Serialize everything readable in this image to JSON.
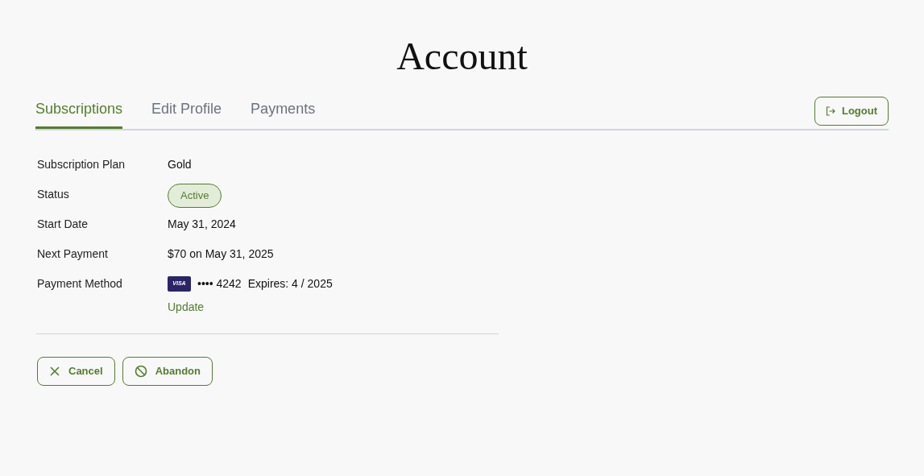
{
  "title": "Account",
  "tabs": [
    {
      "label": "Subscriptions",
      "selected": true
    },
    {
      "label": "Edit Profile",
      "selected": false
    },
    {
      "label": "Payments",
      "selected": false
    }
  ],
  "logout": "Logout",
  "details": [
    {
      "kind": "text",
      "label": "Subscription Plan",
      "value": "Gold"
    },
    {
      "kind": "badge",
      "label": "Status",
      "value": "Active"
    },
    {
      "kind": "text",
      "label": "Start Date",
      "value": "May 31, 2024"
    },
    {
      "kind": "text",
      "label": "Next Payment",
      "value": "$70 on May 31, 2025"
    },
    {
      "kind": "card",
      "label": "Payment Method",
      "brand": "VISA",
      "number": "•••• 4242",
      "expires": "Expires: 4 / 2025",
      "link": "Update"
    }
  ],
  "actions": [
    {
      "kind": "cancel",
      "label": "Cancel"
    },
    {
      "kind": "abandon",
      "label": "Abandon"
    }
  ]
}
